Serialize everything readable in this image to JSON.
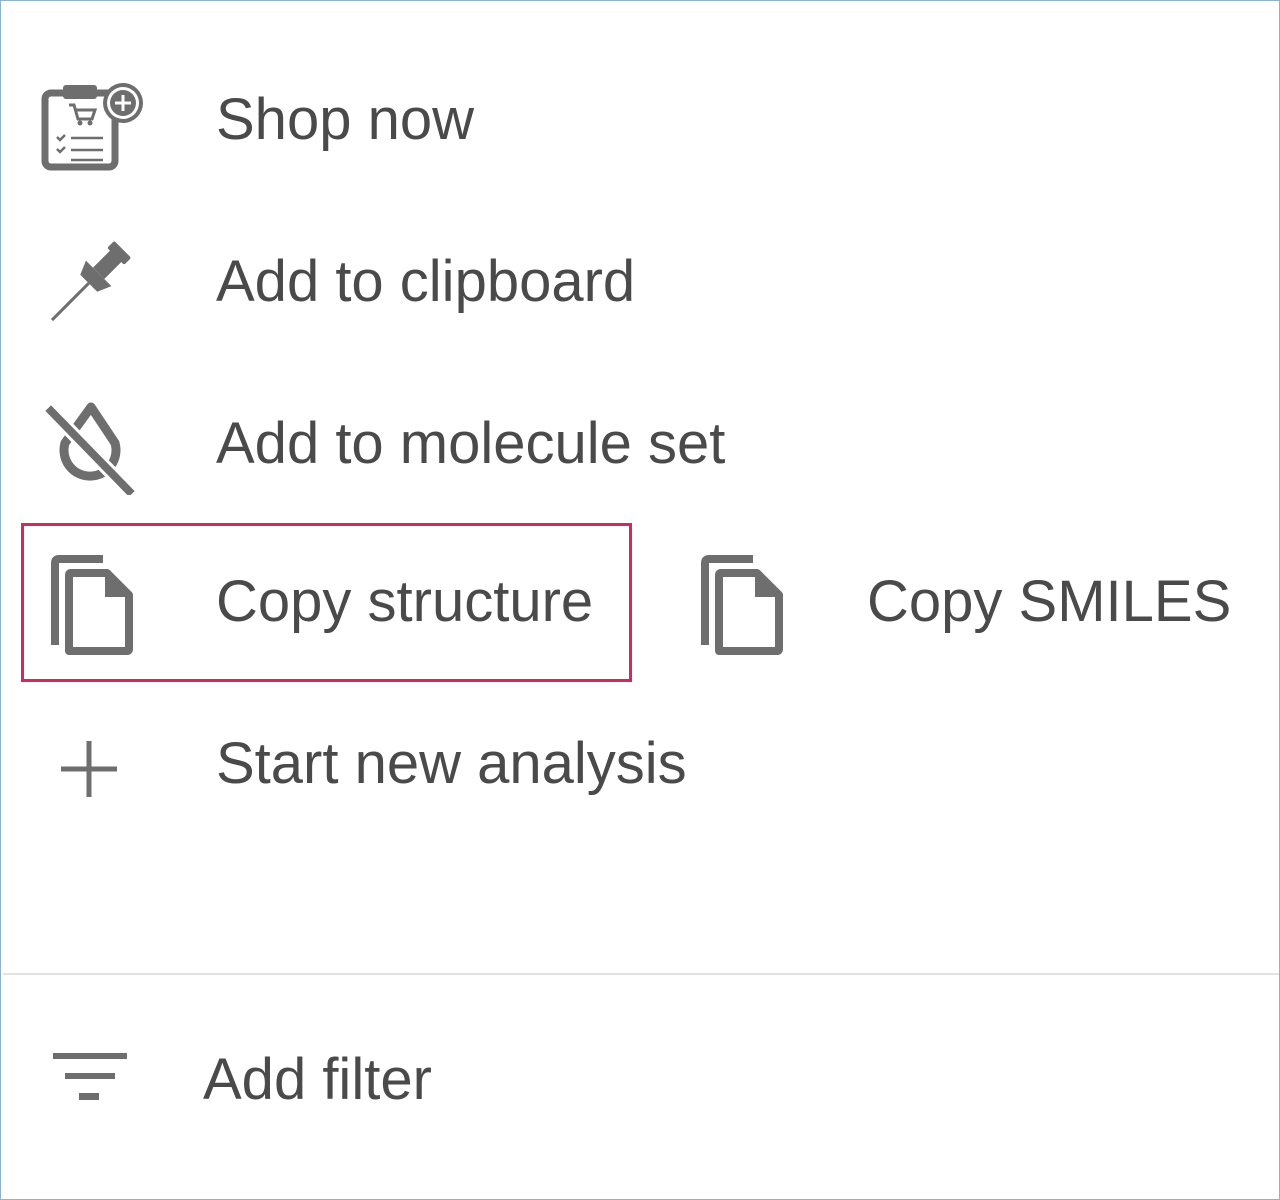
{
  "menu": {
    "items": [
      {
        "label": "Shop now",
        "icon": "shopping-list-add-icon"
      },
      {
        "label": "Add to clipboard",
        "icon": "pushpin-icon"
      },
      {
        "label": "Add to molecule set",
        "icon": "molecule-set-off-icon"
      },
      {
        "label": "Copy structure",
        "icon": "copy-icon"
      },
      {
        "label": "Copy SMILES",
        "icon": "copy-icon"
      },
      {
        "label": "Start new analysis",
        "icon": "plus-icon"
      }
    ],
    "filter": {
      "label": "Add filter",
      "icon": "filter-icon"
    }
  },
  "colors": {
    "icon": "#6e6e6e",
    "text": "#4a4a4a",
    "highlight": "#d6285a",
    "frame_border": "#8fb2cc",
    "divider": "#e2e2e2"
  }
}
